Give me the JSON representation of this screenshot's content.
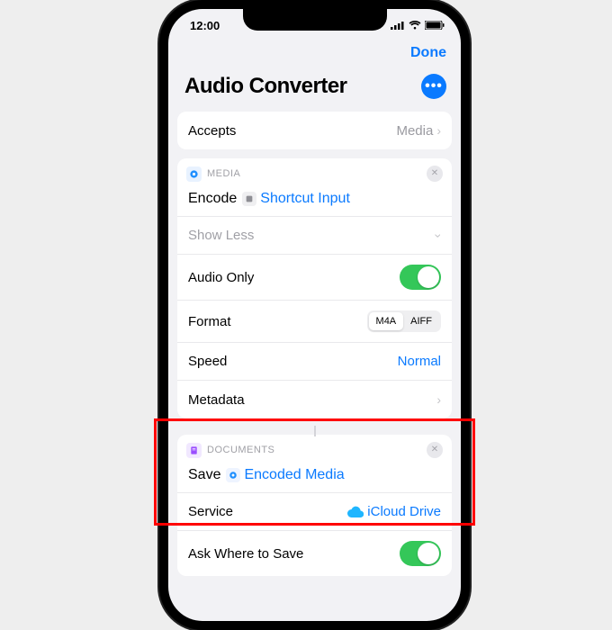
{
  "status_bar": {
    "time": "12:00"
  },
  "header": {
    "done": "Done"
  },
  "title": "Audio Converter",
  "accepts": {
    "label": "Accepts",
    "value": "Media"
  },
  "encode": {
    "section": "MEDIA",
    "verb": "Encode",
    "input_token": "Shortcut Input",
    "show_less": "Show Less",
    "rows": {
      "audio_only": {
        "label": "Audio Only",
        "on": true
      },
      "format": {
        "label": "Format",
        "options": [
          "M4A",
          "AIFF"
        ],
        "selected": "M4A"
      },
      "speed": {
        "label": "Speed",
        "value": "Normal"
      },
      "metadata": {
        "label": "Metadata"
      }
    }
  },
  "save": {
    "section": "DOCUMENTS",
    "verb": "Save",
    "input_token": "Encoded Media",
    "rows": {
      "service": {
        "label": "Service",
        "value": "iCloud Drive"
      },
      "ask_where": {
        "label": "Ask Where to Save",
        "on": true
      }
    }
  }
}
